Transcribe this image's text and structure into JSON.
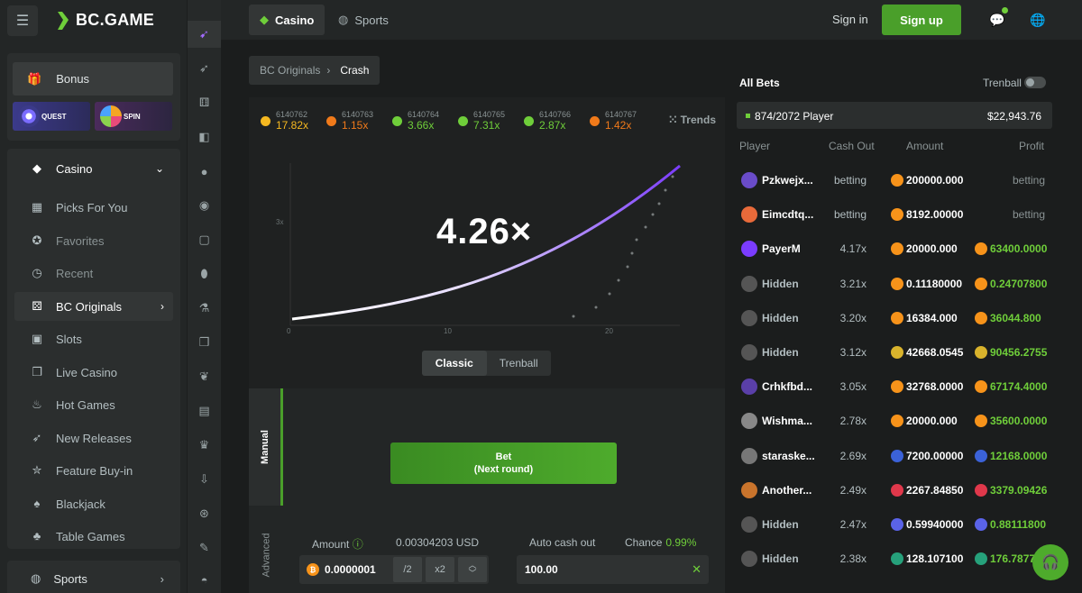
{
  "sidebar": {
    "logo": "BC.GAME",
    "bonus": "Bonus",
    "quest": "QUEST",
    "spin": "SPIN",
    "casino": "Casino",
    "items": [
      "Picks For You",
      "Favorites",
      "Recent",
      "BC Originals",
      "Slots",
      "Live Casino",
      "Hot Games",
      "New Releases",
      "Feature Buy-in",
      "Blackjack",
      "Table Games"
    ],
    "sports": "Sports"
  },
  "topbar": {
    "casino_tab": "Casino",
    "sports_tab": "Sports",
    "signin": "Sign in",
    "signup": "Sign up"
  },
  "breadcrumb": {
    "parent": "BC Originals",
    "current": "Crash"
  },
  "game": {
    "history": [
      {
        "id": "6140762",
        "mult": "17.82x",
        "color": "#f5b820"
      },
      {
        "id": "6140763",
        "mult": "1.15x",
        "color": "#f07a1a"
      },
      {
        "id": "6140764",
        "mult": "3.66x",
        "color": "#6fce3a"
      },
      {
        "id": "6140765",
        "mult": "7.31x",
        "color": "#6fce3a"
      },
      {
        "id": "6140766",
        "mult": "2.87x",
        "color": "#6fce3a"
      },
      {
        "id": "6140767",
        "mult": "1.42x",
        "color": "#f07a1a"
      }
    ],
    "trends": "Trends",
    "multiplier": "4.26×",
    "chart_ticks": {
      "y": "3x",
      "x": [
        "0",
        "10",
        "20"
      ]
    },
    "modes": [
      "Classic",
      "Trenball"
    ],
    "manual": "Manual",
    "advanced": "Advanced",
    "bet_label": "Bet",
    "bet_sub": "(Next round)",
    "amount_label": "Amount",
    "amount_usd": "0.00304203 USD",
    "amount_value": "0.0000001",
    "half": "/2",
    "double": "x2",
    "autocashout_label": "Auto cash out",
    "chance_label": "Chance",
    "chance_value": "0.99%",
    "autocashout_value": "100.00"
  },
  "bets": {
    "title": "All Bets",
    "trenball": "Trenball",
    "count": "874/2072 Player",
    "total": "$22,943.76",
    "headers": [
      "Player",
      "Cash Out",
      "Amount",
      "Profit"
    ],
    "rows": [
      {
        "player": "Pzkwejx...",
        "cashout": "betting",
        "amount": "200000.000",
        "coin": "#f7931a",
        "profit": "betting",
        "pcoin": ""
      },
      {
        "player": "Eimcdtq...",
        "cashout": "betting",
        "amount": "8192.00000",
        "coin": "#f7931a",
        "profit": "betting",
        "pcoin": ""
      },
      {
        "player": "PayerM",
        "cashout": "4.17x",
        "amount": "20000.000",
        "coin": "#f7931a",
        "profit": "63400.0000",
        "pcoin": "#f7931a"
      },
      {
        "player": "Hidden",
        "cashout": "3.21x",
        "amount": "0.11180000",
        "coin": "#f7931a",
        "profit": "0.24707800",
        "pcoin": "#f7931a"
      },
      {
        "player": "Hidden",
        "cashout": "3.20x",
        "amount": "16384.000",
        "coin": "#f7931a",
        "profit": "36044.800",
        "pcoin": "#f7931a"
      },
      {
        "player": "Hidden",
        "cashout": "3.12x",
        "amount": "42668.0545",
        "coin": "#d9b32c",
        "profit": "90456.2755",
        "pcoin": "#d9b32c"
      },
      {
        "player": "Crhkfbd...",
        "cashout": "3.05x",
        "amount": "32768.0000",
        "coin": "#f7931a",
        "profit": "67174.4000",
        "pcoin": "#f7931a"
      },
      {
        "player": "Wishma...",
        "cashout": "2.78x",
        "amount": "20000.000",
        "coin": "#f7931a",
        "profit": "35600.0000",
        "pcoin": "#f7931a"
      },
      {
        "player": "staraske...",
        "cashout": "2.69x",
        "amount": "7200.00000",
        "coin": "#3b62d8",
        "profit": "12168.0000",
        "pcoin": "#3b62d8"
      },
      {
        "player": "Another...",
        "cashout": "2.49x",
        "amount": "2267.84850",
        "coin": "#e0384b",
        "profit": "3379.09426",
        "pcoin": "#e0384b"
      },
      {
        "player": "Hidden",
        "cashout": "2.47x",
        "amount": "0.59940000",
        "coin": "#5a63e8",
        "profit": "0.88111800",
        "pcoin": "#5a63e8"
      },
      {
        "player": "Hidden",
        "cashout": "2.38x",
        "amount": "128.107100",
        "coin": "#26a17b",
        "profit": "176.78770",
        "pcoin": "#26a17b"
      }
    ]
  }
}
